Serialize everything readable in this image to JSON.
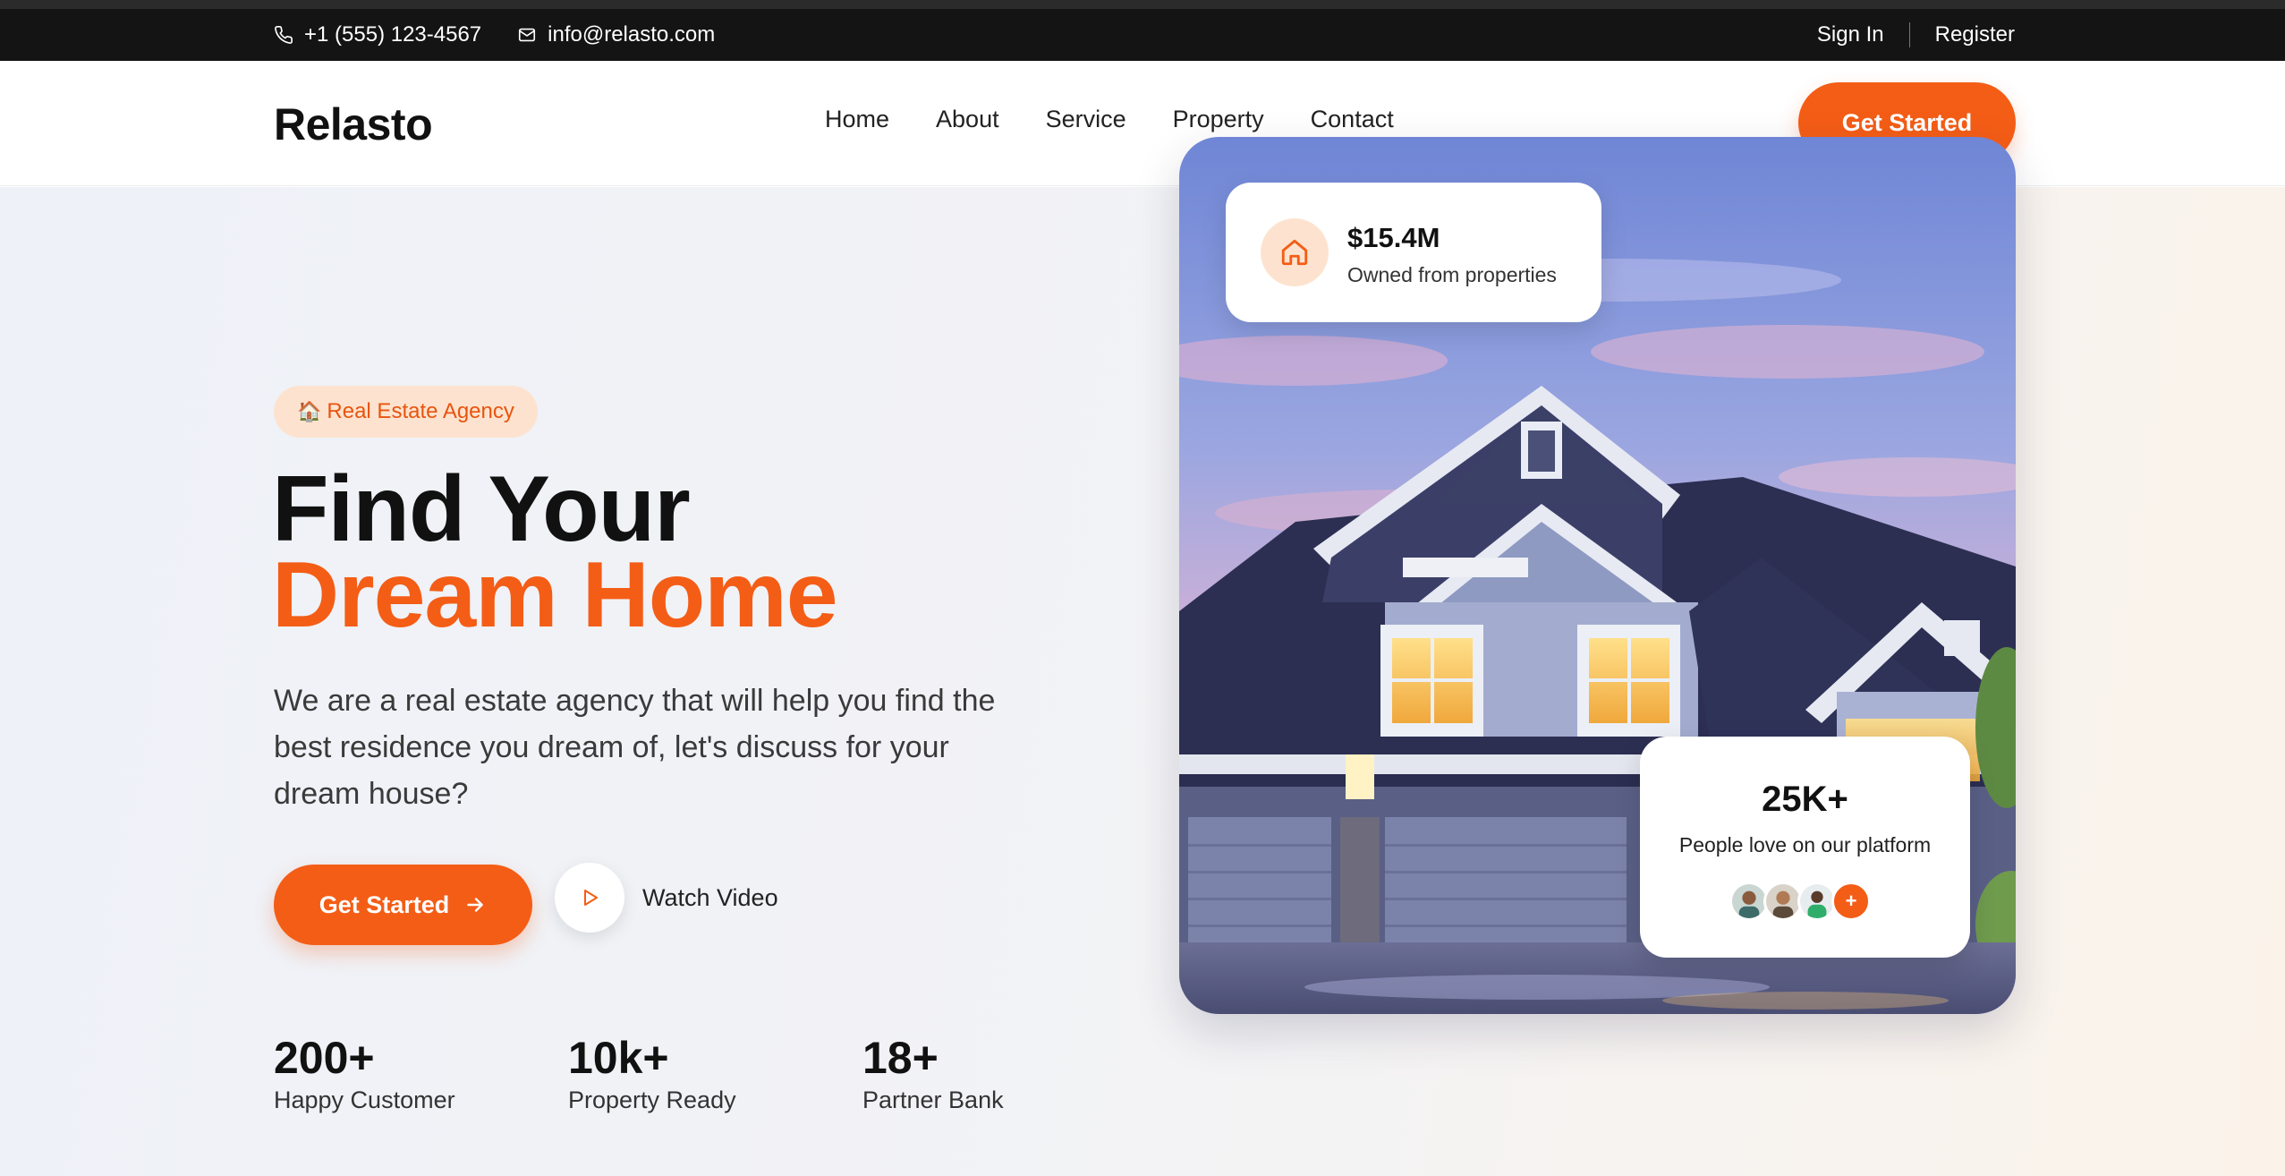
{
  "topbar": {
    "phone": "+1 (555) 123-4567",
    "email": "info@relasto.com",
    "sign_in": "Sign In",
    "register": "Register"
  },
  "navbar": {
    "logo": "Relasto",
    "links": [
      "Home",
      "About",
      "Service",
      "Property",
      "Contact"
    ],
    "cta": "Get Started"
  },
  "hero": {
    "badge": "Real Estate Agency",
    "headline_line1": "Find Your",
    "headline_line2": "Dream Home",
    "description": "We are a real estate agency that will help you find the best residence you dream of, let's discuss for your dream house?",
    "cta": "Get Started",
    "watch_video": "Watch Video",
    "stats": [
      {
        "value": "200+",
        "label": "Happy Customer"
      },
      {
        "value": "10k+",
        "label": "Property Ready"
      },
      {
        "value": "18+",
        "label": "Partner Bank"
      }
    ]
  },
  "cards": {
    "owned": {
      "amount": "$15.4M",
      "label": "Owned from properties"
    },
    "people": {
      "count": "25K+",
      "label": "People love on our platform",
      "more": "+"
    }
  },
  "colors": {
    "accent": "#f45d16",
    "accent_soft": "#fde3cf",
    "topbar_bg": "#141414"
  },
  "icons": {
    "phone": "phone-icon",
    "email": "mail-icon",
    "badge": "house-emoji-icon",
    "cta_arrow": "arrow-right-icon",
    "play": "play-icon",
    "owned": "home-icon"
  }
}
